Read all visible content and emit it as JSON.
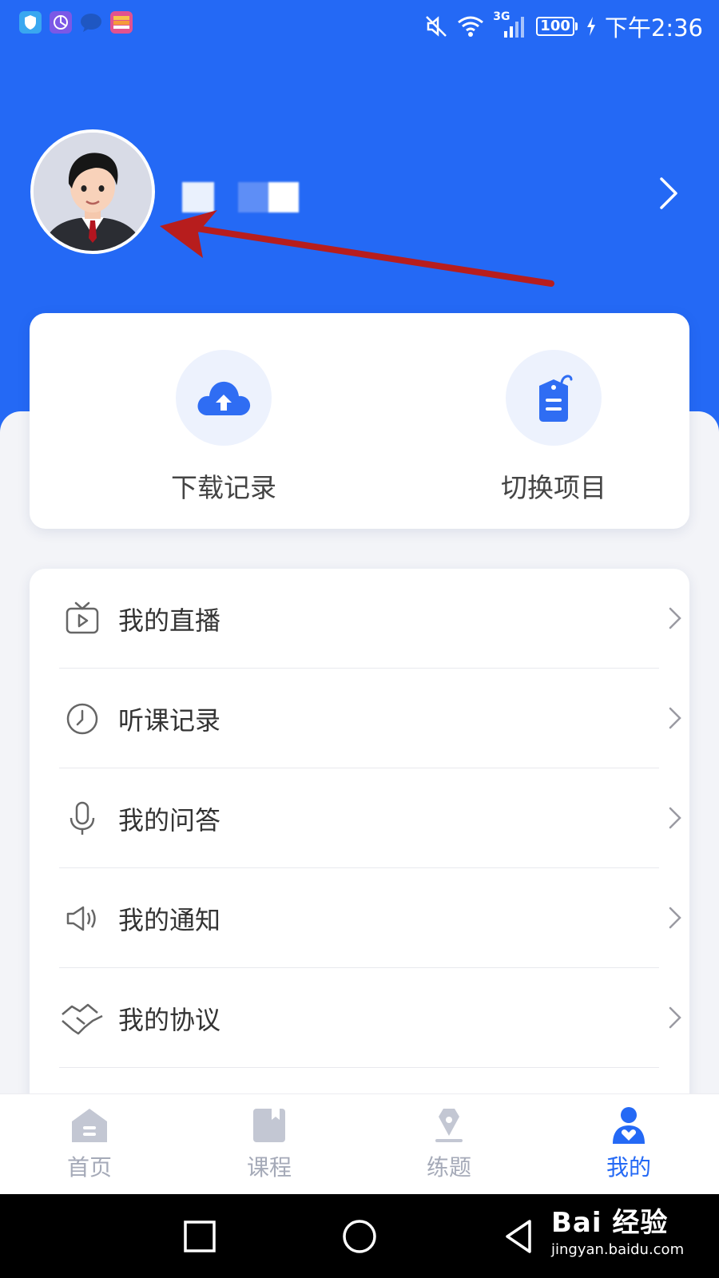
{
  "statusbar": {
    "time": "下午2:36",
    "network": "3G",
    "battery": "100",
    "apps": [
      {
        "icon": "shield-app-icon",
        "color": "#39a7f0"
      },
      {
        "icon": "browser-app-icon",
        "color": "#7b58e6"
      },
      {
        "icon": "message-app-icon",
        "color": "#1f57c2"
      },
      {
        "icon": "wallet-app-icon",
        "color": "#e2528f"
      }
    ]
  },
  "colors": {
    "brand": "#2469f5",
    "page_bg": "#f3f4f8",
    "tab_inactive": "#a5aab8"
  },
  "quick_actions": [
    {
      "label": "下载记录",
      "icon": "cloud-upload-icon"
    },
    {
      "label": "切换项目",
      "icon": "tag-icon"
    }
  ],
  "menu": [
    {
      "label": "我的直播",
      "icon": "tv-play-icon"
    },
    {
      "label": "听课记录",
      "icon": "clock-icon"
    },
    {
      "label": "我的问答",
      "icon": "microphone-icon"
    },
    {
      "label": "我的通知",
      "icon": "megaphone-icon"
    },
    {
      "label": "我的协议",
      "icon": "handshake-icon"
    }
  ],
  "tabs": [
    {
      "label": "首页",
      "icon": "home-icon"
    },
    {
      "label": "课程",
      "icon": "book-icon"
    },
    {
      "label": "练题",
      "icon": "pen-icon"
    },
    {
      "label": "我的",
      "icon": "user-icon",
      "active": true
    }
  ],
  "watermark": {
    "main": "Bai 经验",
    "sub": "jingyan.baidu.com"
  }
}
